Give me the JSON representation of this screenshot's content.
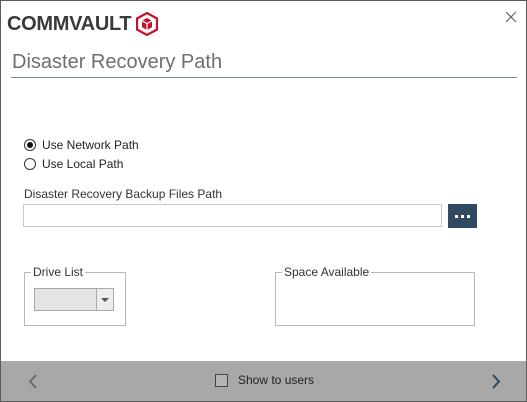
{
  "brand": {
    "name": "COMMVAULT",
    "accent_color": "#c8102e"
  },
  "window": {
    "close_icon": "close-icon"
  },
  "page": {
    "title": "Disaster Recovery Path"
  },
  "path_options": [
    {
      "label": "Use Network Path",
      "selected": true
    },
    {
      "label": "Use Local Path",
      "selected": false
    }
  ],
  "backup_path": {
    "label": "Disaster Recovery Backup Files Path",
    "value": "",
    "browse_icon": "ellipsis-icon",
    "button_color": "#2f4a60"
  },
  "drive_list": {
    "legend": "Drive List",
    "selected": ""
  },
  "space_available": {
    "legend": "Space  Available",
    "value": ""
  },
  "footer": {
    "show_to_users_label": "Show to users",
    "show_to_users_checked": false,
    "back_icon": "chevron-left-icon",
    "next_icon": "chevron-right-icon",
    "background_color": "#a8a8a8"
  }
}
